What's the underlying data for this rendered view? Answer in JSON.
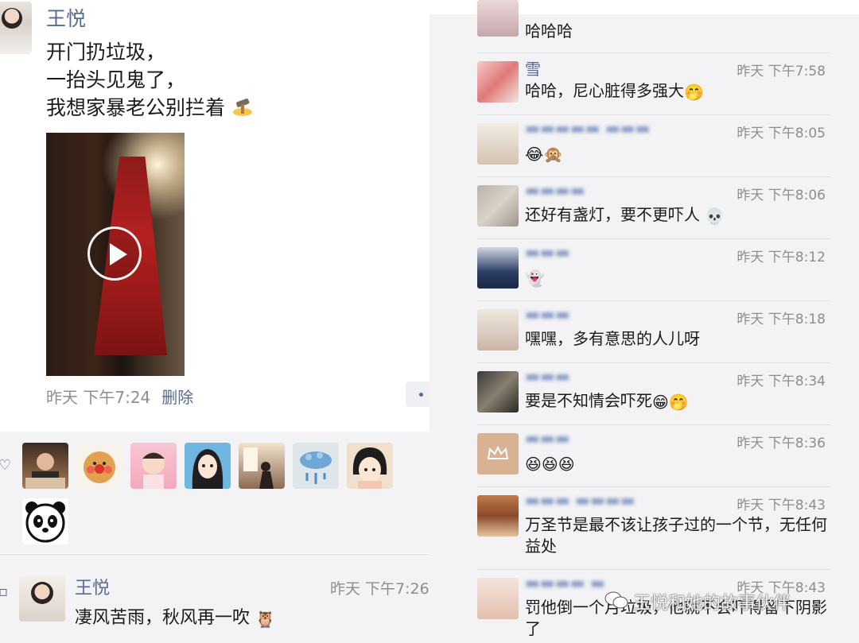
{
  "post": {
    "author": "王悦",
    "lines": [
      "开门扔垃圾，",
      "一抬头见鬼了，",
      "我想家暴老公别拦着"
    ],
    "time": "昨天 下午7:24",
    "delete_label": "删除",
    "video_play_icon": "play-icon"
  },
  "likes": {
    "icon": "heart-icon",
    "avatars": [
      "avatar-1",
      "avatar-2",
      "avatar-3",
      "avatar-4",
      "avatar-5",
      "avatar-6",
      "avatar-7",
      "avatar-8"
    ]
  },
  "comment_main": {
    "name": "王悦",
    "time": "昨天 下午7:26",
    "text": "凄风苦雨，秋风再一吹"
  },
  "right_comments": [
    {
      "name": "",
      "time": "",
      "text": "哈哈哈",
      "emoji": ""
    },
    {
      "name": "雪",
      "time": "昨天 下午7:58",
      "text": "哈哈，尼心脏得多强大",
      "emoji": "🤭"
    },
    {
      "name": "",
      "time": "昨天 下午8:05",
      "text": "",
      "emoji": "😂🙊"
    },
    {
      "name": "",
      "time": "昨天 下午8:06",
      "text": "还好有盏灯，要不更吓人",
      "emoji": "💀"
    },
    {
      "name": "",
      "time": "昨天 下午8:12",
      "text": "",
      "emoji": "👻"
    },
    {
      "name": "",
      "time": "昨天 下午8:18",
      "text": "嘿嘿，多有意思的人儿呀",
      "emoji": ""
    },
    {
      "name": "",
      "time": "昨天 下午8:34",
      "text": "要是不知情会吓死",
      "emoji": "😁🤭"
    },
    {
      "name": "",
      "time": "昨天 下午8:36",
      "text": "",
      "emoji": "😆😆😆"
    },
    {
      "name": "",
      "time": "昨天 下午8:43",
      "text": "万圣节是最不该让孩子过的一个节，无任何益处",
      "emoji": ""
    },
    {
      "name": "",
      "time": "昨天 下午8:43",
      "text": "罚他倒一个月垃圾，他就不会吓得留下阴影了",
      "emoji": ""
    }
  ],
  "watermark": "王悦和她的故事伙伴"
}
